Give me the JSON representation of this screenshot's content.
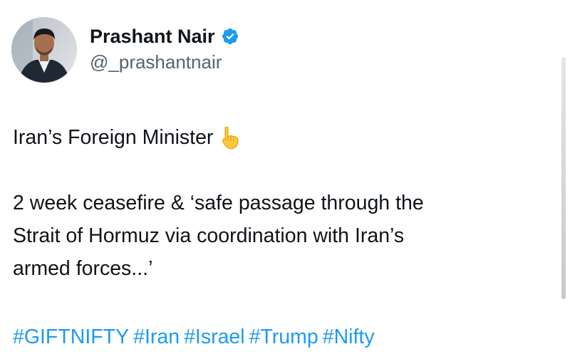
{
  "author": {
    "display_name": "Prashant Nair",
    "handle": "@_prashantnair",
    "verified": true,
    "avatar_icon": "profile-photo-icon",
    "verified_icon": "verified-badge-icon"
  },
  "tweet": {
    "line1": "Iran’s Foreign Minister",
    "line1_emoji": "backhand-index-pointing-down-icon",
    "line2": "2 week ceasefire & ‘safe passage through the",
    "line3": "Strait of Hormuz via coordination with Iran’s",
    "line4": "armed forces...’",
    "hashtags": [
      "#GIFTNIFTY",
      "#Iran",
      "#Israel",
      "#Trump",
      "#Nifty"
    ]
  },
  "colors": {
    "text": "#0f1419",
    "secondary_text": "#536471",
    "link": "#1d9bf0",
    "verified_badge": "#1d9bf0",
    "background": "#ffffff"
  }
}
